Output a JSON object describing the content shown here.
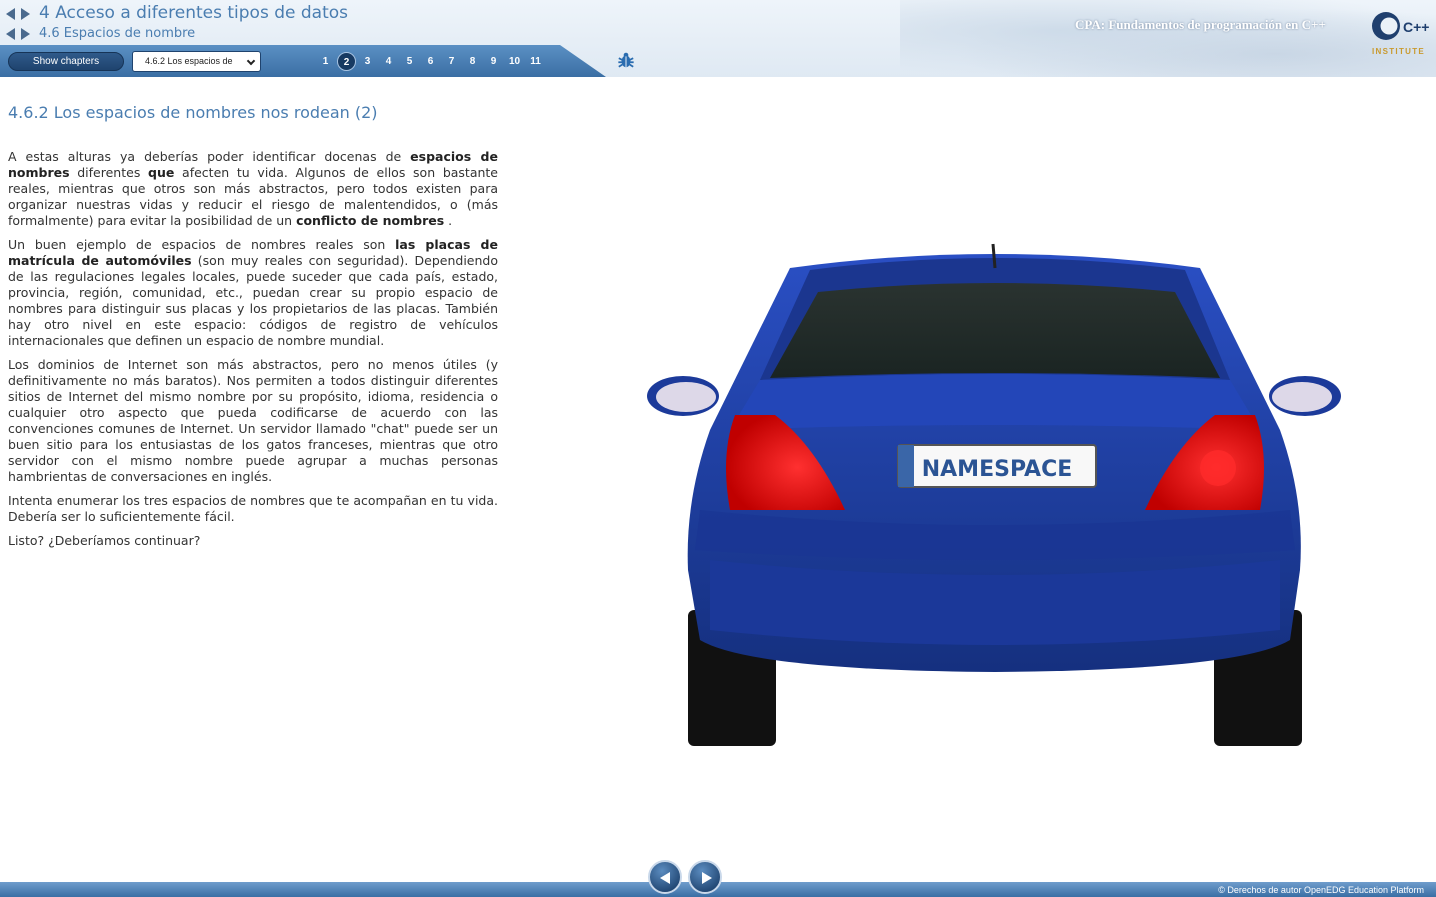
{
  "header": {
    "chapter_title": "4 Acceso a diferentes tipos de datos",
    "section_title": "4.6 Espacios de nombre",
    "course_title": "CPA: Fundamentos de programación en C++",
    "logo_text": "INSTITUTE",
    "logo_mark": "C++"
  },
  "toolbar": {
    "show_chapters_label": "Show chapters",
    "section_select_value": "4.6.2 Los espacios de",
    "pages": [
      "1",
      "2",
      "3",
      "4",
      "5",
      "6",
      "7",
      "8",
      "9",
      "10",
      "11"
    ],
    "active_page": "2",
    "bug_icon": "bug-icon"
  },
  "content": {
    "heading": "4.6.2 Los espacios de nombres nos rodean (2)",
    "p1": {
      "a": "A estas alturas ya deberías poder identificar docenas de ",
      "b1": "espacios de nombres",
      "c": " diferentes ",
      "b2": "que",
      "d": " afecten tu vida. Algunos de ellos son bastante reales, mientras que otros son más abstractos, pero todos existen para organizar nuestras vidas y reducir el riesgo de malentendidos, o (más formalmente) para evitar la posibilidad de un ",
      "b3": "conflicto de nombres",
      "e": " ."
    },
    "p2": {
      "a": "Un buen ejemplo de espacios de nombres reales son ",
      "b1": "las placas de matrícula de automóviles",
      "c": " (son muy reales con seguridad). Dependiendo de las regulaciones legales locales, puede suceder que cada país, estado, provincia, región, comunidad, etc., puedan crear su propio espacio de nombres para distinguir sus placas y los propietarios de las placas. También hay otro nivel en este espacio: códigos de registro de vehículos internacionales que definen un espacio de nombre mundial."
    },
    "p3": "Los dominios de Internet son más abstractos, pero no menos útiles (y definitivamente no más baratos). Nos permiten a todos distinguir diferentes sitios de Internet del mismo nombre por su propósito, idioma, residencia o cualquier otro aspecto que pueda codificarse de acuerdo con las convenciones comunes de Internet. Un servidor llamado \"chat\" puede ser un buen sitio para los entusiastas de los gatos franceses, mientras que otro servidor con el mismo nombre puede agrupar a muchas personas hambrientas de conversaciones en inglés.",
    "p4": "Intenta enumerar los tres espacios de nombres que te acompañan en tu vida. Debería ser lo suficientemente fácil.",
    "p5": "Listo? ¿Deberíamos continuar?",
    "plate_text": "NAMESPACE"
  },
  "footer": {
    "copyright": "© Derechos de autor OpenEDG Education Platform"
  },
  "colors": {
    "accent": "#4a7db0",
    "toolbar": "#3a6ea4",
    "car_body": "#1f3fa8",
    "tail_light": "#e01010"
  }
}
